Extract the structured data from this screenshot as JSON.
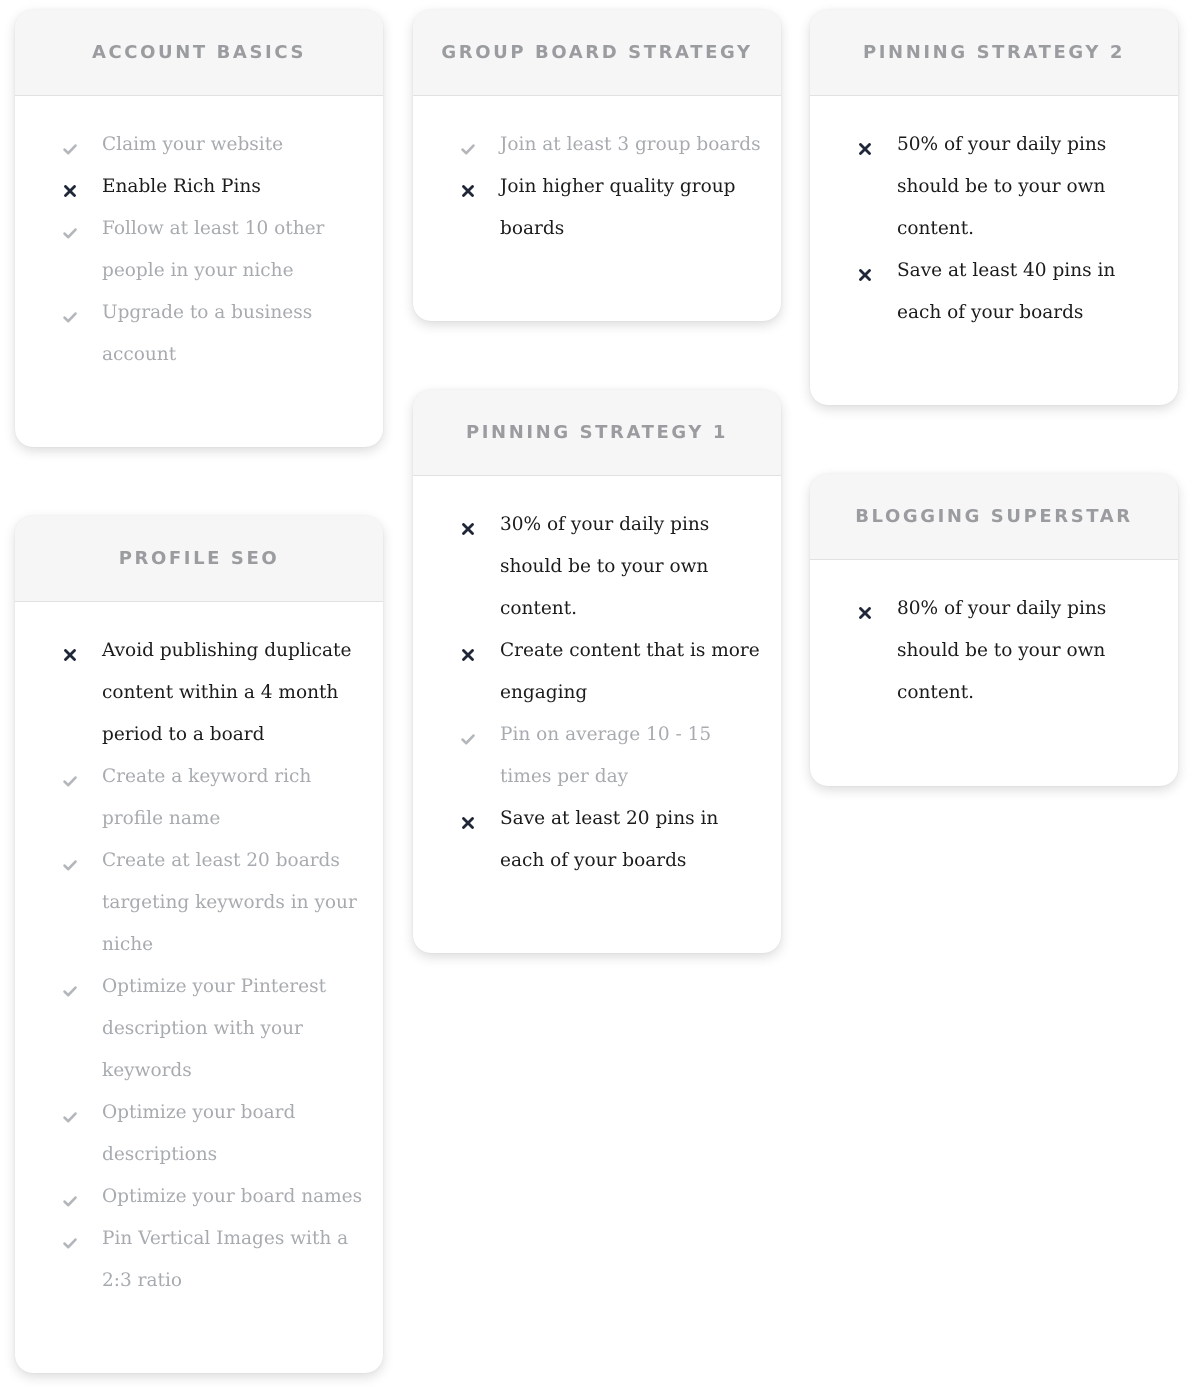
{
  "colors": {
    "check": "#b3b6ba",
    "cross": "#1f2738",
    "done_text": "#a7abaf",
    "todo_text": "#1b1b1b",
    "title": "#9a9ca0",
    "header_bg": "#f6f6f6"
  },
  "cards": [
    {
      "id": "account-basics",
      "title": "ACCOUNT BASICS",
      "items": [
        {
          "status": "done",
          "icon": "check-icon",
          "text": "Claim your website"
        },
        {
          "status": "todo",
          "icon": "cross-icon",
          "text": "Enable Rich Pins"
        },
        {
          "status": "done",
          "icon": "check-icon",
          "text": "Follow at least 10 other people in your niche"
        },
        {
          "status": "done",
          "icon": "check-icon",
          "text": "Upgrade to a business account"
        }
      ]
    },
    {
      "id": "group-board-strategy",
      "title": "GROUP BOARD STRATEGY",
      "items": [
        {
          "status": "done",
          "icon": "check-icon",
          "text": "Join at least 3 group boards"
        },
        {
          "status": "todo",
          "icon": "cross-icon",
          "text": "Join higher quality group boards"
        }
      ]
    },
    {
      "id": "pinning-strategy-2",
      "title": "PINNING STRATEGY 2",
      "items": [
        {
          "status": "todo",
          "icon": "cross-icon",
          "text": "50% of your daily pins should be to your own content."
        },
        {
          "status": "todo",
          "icon": "cross-icon",
          "text": "Save at least 40 pins in each of your boards"
        }
      ]
    },
    {
      "id": "pinning-strategy-1",
      "title": "PINNING STRATEGY 1",
      "items": [
        {
          "status": "todo",
          "icon": "cross-icon",
          "text": "30% of your daily pins should be to your own content."
        },
        {
          "status": "todo",
          "icon": "cross-icon",
          "text": "Create content that is more engaging"
        },
        {
          "status": "done",
          "icon": "check-icon",
          "text": "Pin on average 10 - 15 times per day"
        },
        {
          "status": "todo",
          "icon": "cross-icon",
          "text": "Save at least 20 pins in each of your boards"
        }
      ]
    },
    {
      "id": "blogging-superstar",
      "title": "BLOGGING SUPERSTAR",
      "items": [
        {
          "status": "todo",
          "icon": "cross-icon",
          "text": "80% of your daily pins should be to your own content."
        }
      ]
    },
    {
      "id": "profile-seo",
      "title": "PROFILE SEO",
      "items": [
        {
          "status": "todo",
          "icon": "cross-icon",
          "text": "Avoid publishing duplicate content within a 4 month period to a board"
        },
        {
          "status": "done",
          "icon": "check-icon",
          "text": "Create a keyword rich profile name"
        },
        {
          "status": "done",
          "icon": "check-icon",
          "text": "Create at least 20 boards targeting keywords in your niche"
        },
        {
          "status": "done",
          "icon": "check-icon",
          "text": "Optimize your Pinterest description with your keywords"
        },
        {
          "status": "done",
          "icon": "check-icon",
          "text": "Optimize your board descriptions"
        },
        {
          "status": "done",
          "icon": "check-icon",
          "text": "Optimize your board names"
        },
        {
          "status": "done",
          "icon": "check-icon",
          "text": "Pin Vertical Images with a 2:3 ratio"
        }
      ]
    }
  ]
}
